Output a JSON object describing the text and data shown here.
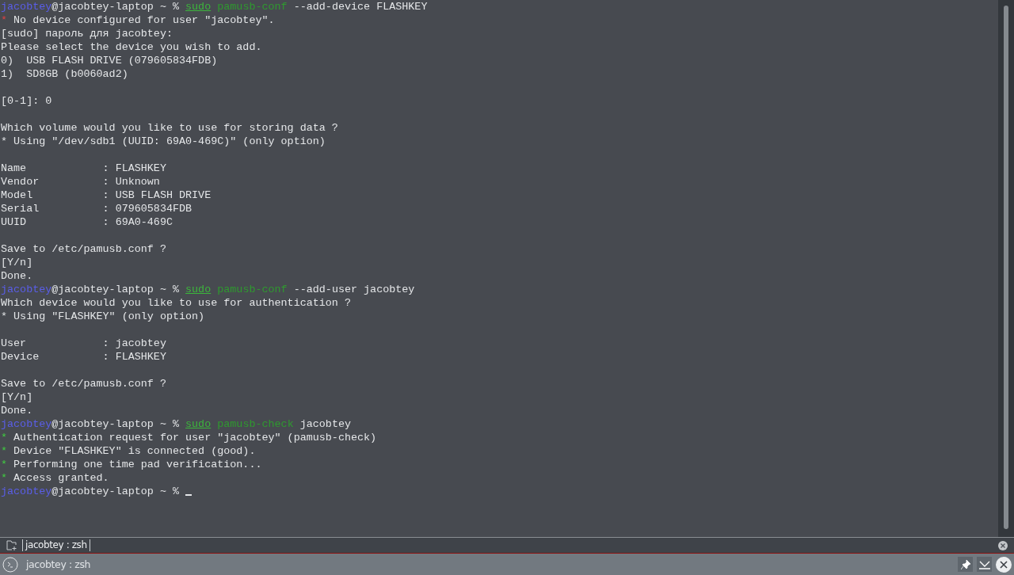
{
  "terminal": {
    "lines": [
      {
        "segments": [
          {
            "text": "jacobtey",
            "kind": "user"
          },
          {
            "text": "@jacobtey-laptop ~ % ",
            "kind": "plain"
          },
          {
            "text": "sudo",
            "kind": "sudo"
          },
          {
            "text": " pamusb-conf",
            "kind": "cmd"
          },
          {
            "text": " --add-device FLASHKEY",
            "kind": "plain"
          }
        ]
      },
      {
        "segments": [
          {
            "text": "*",
            "kind": "bullet_error"
          },
          {
            "text": " No device configured for user \"jacobtey\".",
            "kind": "plain"
          }
        ]
      },
      {
        "segments": [
          {
            "text": "[sudo] пароль для jacobtey:",
            "kind": "plain"
          }
        ]
      },
      {
        "segments": [
          {
            "text": "Please select the device you wish to add.",
            "kind": "plain"
          }
        ]
      },
      {
        "segments": [
          {
            "text": "0)  USB FLASH DRIVE (079605834FDB)",
            "kind": "plain"
          }
        ]
      },
      {
        "segments": [
          {
            "text": "1)  SD8GB (b0060ad2)",
            "kind": "plain"
          }
        ]
      },
      {
        "space_before": true,
        "segments": [
          {
            "text": "[0-1]: 0",
            "kind": "plain"
          }
        ]
      },
      {
        "space_before": true,
        "segments": [
          {
            "text": "Which volume would you like to use for storing data ?",
            "kind": "plain"
          }
        ]
      },
      {
        "segments": [
          {
            "text": "* Using \"/dev/sdb1 (UUID: 69A0-469C)\" (only option)",
            "kind": "plain"
          }
        ]
      },
      {
        "space_before": true,
        "segments": [
          {
            "text": "Name            : FLASHKEY",
            "kind": "plain"
          }
        ]
      },
      {
        "segments": [
          {
            "text": "Vendor          : Unknown",
            "kind": "plain"
          }
        ]
      },
      {
        "segments": [
          {
            "text": "Model           : USB FLASH DRIVE",
            "kind": "plain"
          }
        ]
      },
      {
        "segments": [
          {
            "text": "Serial          : 079605834FDB",
            "kind": "plain"
          }
        ]
      },
      {
        "segments": [
          {
            "text": "UUID            : 69A0-469C",
            "kind": "plain"
          }
        ]
      },
      {
        "space_before": true,
        "segments": [
          {
            "text": "Save to /etc/pamusb.conf ?",
            "kind": "plain"
          }
        ]
      },
      {
        "segments": [
          {
            "text": "[Y/n]",
            "kind": "plain"
          }
        ]
      },
      {
        "segments": [
          {
            "text": "Done.",
            "kind": "plain"
          }
        ]
      },
      {
        "segments": [
          {
            "text": "jacobtey",
            "kind": "user"
          },
          {
            "text": "@jacobtey-laptop ~ % ",
            "kind": "plain"
          },
          {
            "text": "sudo",
            "kind": "sudo"
          },
          {
            "text": " pamusb-conf",
            "kind": "cmd"
          },
          {
            "text": " --add-user jacobtey",
            "kind": "plain"
          }
        ]
      },
      {
        "segments": [
          {
            "text": "Which device would you like to use for authentication ?",
            "kind": "plain"
          }
        ]
      },
      {
        "segments": [
          {
            "text": "* Using \"FLASHKEY\" (only option)",
            "kind": "plain"
          }
        ]
      },
      {
        "space_before": true,
        "segments": [
          {
            "text": "User            : jacobtey",
            "kind": "plain"
          }
        ]
      },
      {
        "segments": [
          {
            "text": "Device          : FLASHKEY",
            "kind": "plain"
          }
        ]
      },
      {
        "space_before": true,
        "segments": [
          {
            "text": "Save to /etc/pamusb.conf ?",
            "kind": "plain"
          }
        ]
      },
      {
        "segments": [
          {
            "text": "[Y/n]",
            "kind": "plain"
          }
        ]
      },
      {
        "segments": [
          {
            "text": "Done.",
            "kind": "plain"
          }
        ]
      },
      {
        "segments": [
          {
            "text": "jacobtey",
            "kind": "user"
          },
          {
            "text": "@jacobtey-laptop ~ % ",
            "kind": "plain"
          },
          {
            "text": "sudo",
            "kind": "sudo"
          },
          {
            "text": " pamusb-check",
            "kind": "cmd"
          },
          {
            "text": " jacobtey",
            "kind": "plain"
          }
        ]
      },
      {
        "segments": [
          {
            "text": "*",
            "kind": "bullet_ok"
          },
          {
            "text": " Authentication request for user \"jacobtey\" (pamusb-check)",
            "kind": "plain"
          }
        ]
      },
      {
        "segments": [
          {
            "text": "*",
            "kind": "bullet_ok"
          },
          {
            "text": " Device \"FLASHKEY\" is connected (good).",
            "kind": "plain"
          }
        ]
      },
      {
        "segments": [
          {
            "text": "*",
            "kind": "bullet_ok"
          },
          {
            "text": " Performing one time pad verification...",
            "kind": "plain"
          }
        ]
      },
      {
        "segments": [
          {
            "text": "*",
            "kind": "bullet_ok"
          },
          {
            "text": " Access granted.",
            "kind": "plain"
          }
        ]
      },
      {
        "cursor": true,
        "segments": [
          {
            "text": "jacobtey",
            "kind": "user"
          },
          {
            "text": "@jacobtey-laptop ~ % ",
            "kind": "plain"
          }
        ]
      }
    ]
  },
  "tabs": [
    {
      "label": "jacobtey : zsh",
      "selected": true
    }
  ],
  "window": {
    "title": "jacobtey : zsh"
  }
}
